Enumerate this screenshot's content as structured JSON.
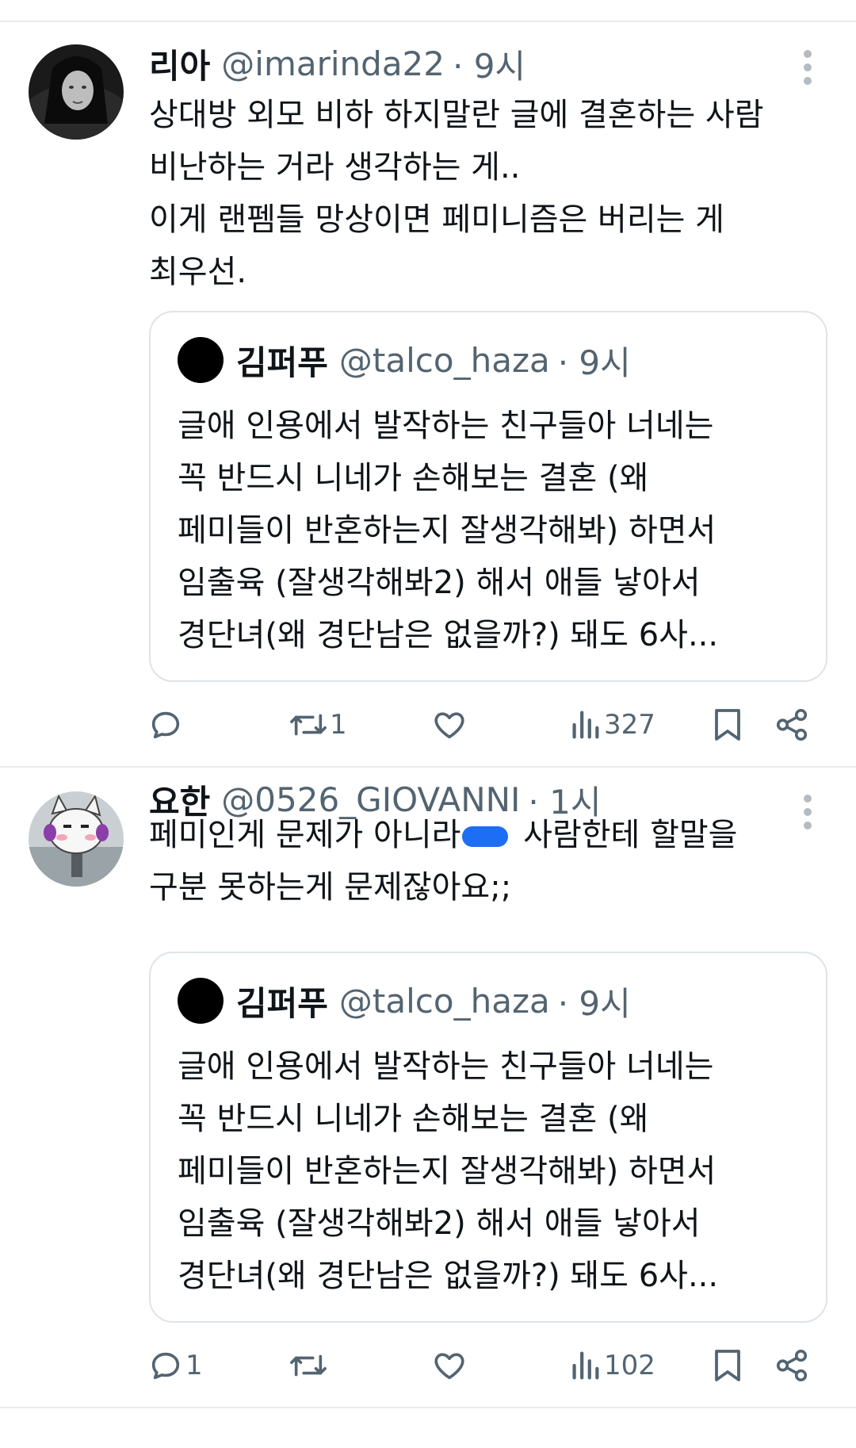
{
  "tweets": [
    {
      "name": "리아",
      "handle": "@imarinda22",
      "time": "· 9시",
      "lines": [
        "상대방 외모 비하 하지말란 글에 결혼하는 사람",
        "비난하는 거라 생각하는 게..",
        "이게 랜펨들 망상이면 페미니즘은 버리는 게",
        "최우선."
      ],
      "quote": {
        "name": "김퍼푸",
        "handle": "@talco_haza",
        "time": "· 9시",
        "lines": [
          "글애 인용에서 발작하는 친구들아 너네는",
          "꼭 반드시 니네가 손해보는 결혼 (왜",
          "페미들이 반혼하는지 잘생각해봐) 하면서",
          "임출육 (잘생각해봐2) 해서 애들 낳아서",
          "경단녀(왜 경단남은 없을까?) 돼도 6사..."
        ]
      },
      "stats": {
        "replies": "",
        "reposts": "1",
        "views": "327"
      },
      "icons": [
        "reply-icon",
        "repost-icon",
        "like-icon",
        "views-icon",
        "bookmark-icon",
        "share-icon"
      ]
    },
    {
      "name": "요한",
      "handle": "@0526_GIOVANNI",
      "time": "· 1시",
      "line1_before": "페미인게 문제가 아니라",
      "line1_after": " 사람한테 할말을",
      "line2": "구분 못하는게 문제잖아요;;",
      "quote": {
        "name": "김퍼푸",
        "handle": "@talco_haza",
        "time": "· 9시",
        "lines": [
          "글애 인용에서 발작하는 친구들아 너네는",
          "꼭 반드시 니네가 손해보는 결혼 (왜",
          "페미들이 반혼하는지 잘생각해봐) 하면서",
          "임출육 (잘생각해봐2) 해서 애들 낳아서",
          "경단녀(왜 경단남은 없을까?) 돼도 6사..."
        ]
      },
      "stats": {
        "replies": "1",
        "reposts": "",
        "views": "102"
      }
    }
  ],
  "colors": {
    "text": "#0f1419",
    "secondary": "#536471",
    "border": "#dfe4e8",
    "redaction": "#1d6df5"
  }
}
